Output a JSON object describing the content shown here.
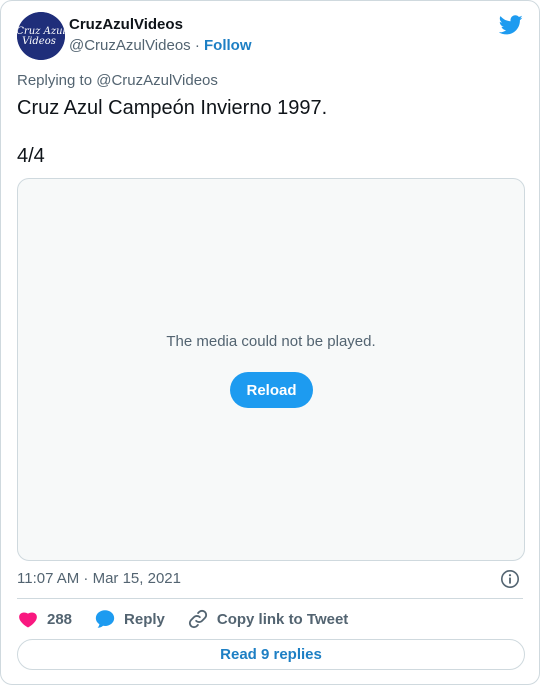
{
  "author": {
    "name": "CruzAzulVideos",
    "handle": "@CruzAzulVideos",
    "separator": " · ",
    "follow_label": "Follow",
    "avatar_text_line1": "Cruz Azul",
    "avatar_text_line2": "Videos"
  },
  "tweet": {
    "reply_context": "Replying to @CruzAzulVideos",
    "text": "Cruz Azul Campeón Invierno 1997.\n\n4/4",
    "timestamp": "11:07 AM · Mar 15, 2021"
  },
  "media": {
    "message": "The media could not be played.",
    "reload_label": "Reload"
  },
  "actions": {
    "like_count": "288",
    "reply_label": "Reply",
    "copy_link_label": "Copy link to Tweet"
  },
  "footer": {
    "read_replies_label": "Read 9 replies"
  },
  "colors": {
    "brand_blue": "#1d9bf0",
    "link_blue": "#1d7fc4",
    "like_pink": "#f91880",
    "avatar_bg": "#1f2e7a"
  }
}
